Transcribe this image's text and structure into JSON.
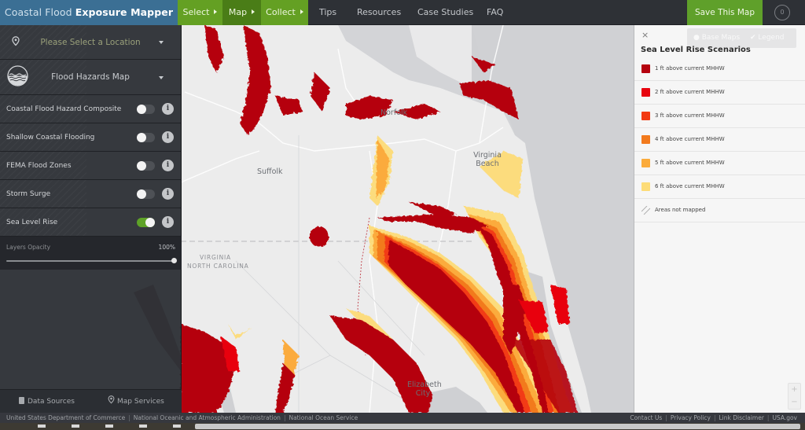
{
  "app": {
    "title_prefix": "Coastal Flood",
    "title_bold": "Exposure Mapper"
  },
  "workflow_steps": [
    {
      "label": "Select",
      "active": false
    },
    {
      "label": "Map",
      "active": true
    },
    {
      "label": "Collect",
      "active": false
    }
  ],
  "nav_links": [
    "Tips",
    "Resources",
    "Case Studies",
    "FAQ"
  ],
  "toolbar": {
    "save_label": "Save This Map",
    "saved_count": "0"
  },
  "left_panel": {
    "location_placeholder": "Please Select a Location",
    "map_select": "Flood Hazards Map",
    "layers": [
      {
        "name": "Coastal Flood Hazard Composite",
        "enabled": false
      },
      {
        "name": "Shallow Coastal Flooding",
        "enabled": false
      },
      {
        "name": "FEMA Flood Zones",
        "enabled": false
      },
      {
        "name": "Storm Surge",
        "enabled": false
      },
      {
        "name": "Sea Level Rise",
        "enabled": true
      }
    ],
    "info_glyph": "i",
    "opacity": {
      "label": "Layers Opacity",
      "value_text": "100%",
      "value": 100
    },
    "footer": {
      "data_sources": "Data Sources",
      "map_services": "Map Services"
    }
  },
  "legend": {
    "close_glyph": "×",
    "tabs": [
      "Base Maps",
      "Legend"
    ],
    "title": "Sea Level Rise Scenarios",
    "items": [
      {
        "label": "1 ft above current MHHW",
        "color": "#b5020f"
      },
      {
        "label": "2 ft above current MHHW",
        "color": "#e8040f"
      },
      {
        "label": "3 ft above current MHHW",
        "color": "#f23b13"
      },
      {
        "label": "4 ft above current MHHW",
        "color": "#f27a1d"
      },
      {
        "label": "5 ft above current MHHW",
        "color": "#fbab3c"
      },
      {
        "label": "6 ft above current MHHW",
        "color": "#fddc78"
      },
      {
        "label": "Areas not mapped",
        "color": "hatch"
      }
    ],
    "zoom_in": "+",
    "zoom_out": "−"
  },
  "map": {
    "places": [
      "Norfolk",
      "Suffolk",
      "Virginia Beach",
      "Elizabeth City"
    ],
    "state_labels": [
      "VIRGINIA",
      "NORTH CAROLINA"
    ]
  },
  "footer": {
    "agencies": [
      "United States Department of Commerce",
      "National Oceanic and Atmospheric Administration",
      "National Ocean Service"
    ],
    "links": [
      "Contact Us",
      "Privacy Policy",
      "Link Disclaimer",
      "USA.gov"
    ]
  }
}
